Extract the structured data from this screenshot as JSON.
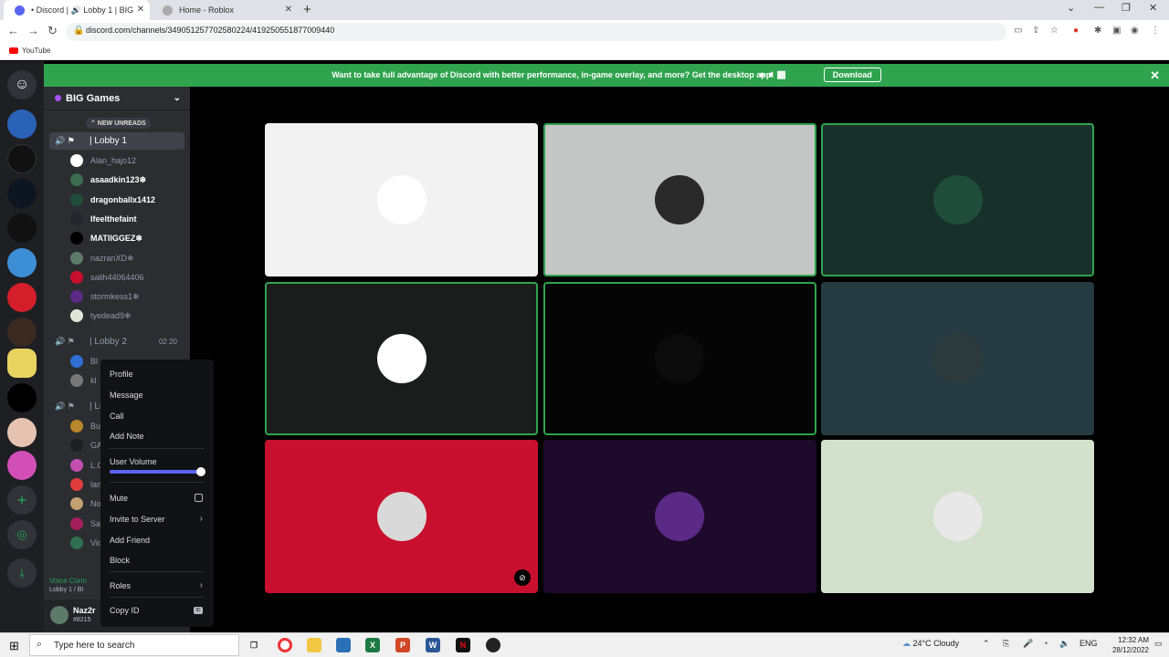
{
  "browser": {
    "tabs": [
      {
        "label": "• Discord | 🔊 Lobby 1 | BIG",
        "close": "✕"
      },
      {
        "label": "Home - Roblox",
        "close": "✕"
      }
    ],
    "new_tab": "+",
    "url": "discord.com/channels/349051257702580224/419250551877009440",
    "bookmark": "YouTube",
    "icons": {
      "back": "←",
      "forward": "→",
      "reload": "↻",
      "lock": "🔒",
      "minimize": "—",
      "maximize": "❐",
      "close": "✕",
      "dropdown": "⌄"
    }
  },
  "banner": {
    "text": "Want to take full advantage of Discord with better performance, in-game overlay, and more? Get the desktop app!",
    "download_label": "Download",
    "close": "✕"
  },
  "server": {
    "name": "BIG Games",
    "new_unreads": "⌃ NEW UNREADS",
    "channels": [
      {
        "name": "| Lobby 1",
        "active": true
      },
      {
        "name": "| Lobby 2",
        "count_a": "02",
        "count_b": "20"
      },
      {
        "name": "| Lo"
      }
    ],
    "lobby1_members": [
      {
        "name": "Alan_hajo12",
        "bright": false,
        "color": "#ffffff"
      },
      {
        "name": "asaadkin123❄",
        "bright": true,
        "color": "#3b6b4f"
      },
      {
        "name": "dragonballx1412",
        "bright": true,
        "color": "#1f4d3a"
      },
      {
        "name": "lfeelthefaint",
        "bright": true,
        "color": "#23262a"
      },
      {
        "name": "MATIIGGEZ❄",
        "bright": true,
        "color": "#000000"
      },
      {
        "name": "nazranXD❄",
        "bright": false,
        "color": "#5d7a6a"
      },
      {
        "name": "salih44064406",
        "bright": false,
        "color": "#c8102e"
      },
      {
        "name": "stormkess1❄",
        "bright": false,
        "color": "#5b2a86"
      },
      {
        "name": "tyedead9❄",
        "bright": false,
        "color": "#dfe6d8"
      }
    ],
    "lobby2_members": [
      {
        "name": "Bl",
        "color": "#2f6fd6"
      },
      {
        "name": "kl",
        "color": "#777777"
      }
    ],
    "lobby3_members": [
      {
        "name": "Bu",
        "color": "#b8862b"
      },
      {
        "name": "GA",
        "color": "#1e1f22"
      },
      {
        "name": "L.C",
        "color": "#c34fb0"
      },
      {
        "name": "lan",
        "color": "#e03e3e"
      },
      {
        "name": "No",
        "color": "#c4a070"
      },
      {
        "name": "Sa",
        "color": "#a3205a"
      },
      {
        "name": "Vic",
        "color": "#2f6f4f"
      }
    ]
  },
  "voice": {
    "status": "Voice Conn",
    "channel": "Lobby 1 / BI"
  },
  "user": {
    "name": "Naz2r",
    "tag": "#8215"
  },
  "context_menu": {
    "items": [
      "Profile",
      "Message",
      "Call",
      "Add Note"
    ],
    "volume_label": "User Volume",
    "volume_percent": 100,
    "mute": "Mute",
    "invite": "Invite to Server",
    "add_friend": "Add Friend",
    "block": "Block",
    "roles": "Roles",
    "copy_id": "Copy ID",
    "chevron": "›",
    "id_badge": "ID"
  },
  "tiles": [
    {
      "bg": "#f2f2f2",
      "avatar": "#ffffff",
      "speaking": false
    },
    {
      "bg": "#c4c6c5",
      "avatar": "#2a2a2a",
      "speaking": true
    },
    {
      "bg": "#18302a",
      "avatar": "#1f4d3a",
      "speaking": true
    },
    {
      "bg": "#1a1d1c",
      "avatar": "#ffffff",
      "speaking": true
    },
    {
      "bg": "#050505",
      "avatar": "#0b0b0b",
      "speaking": true
    },
    {
      "bg": "#253b41",
      "avatar": "#2c3a3c",
      "speaking": false
    },
    {
      "bg": "#c8102e",
      "avatar": "#d9d9d9",
      "speaking": false,
      "muted": true
    },
    {
      "bg": "#1e0a2a",
      "avatar": "#5b2a86",
      "speaking": false
    },
    {
      "bg": "#d2e0cc",
      "avatar": "#e8e8e8",
      "speaking": false
    }
  ],
  "taskbar": {
    "search_placeholder": "Type here to search",
    "weather": "24°C  Cloudy",
    "lang": "ENG",
    "time": "12:32 AM",
    "date": "28/12/2022",
    "start_icon": "⊞",
    "search_icon": "⌕"
  }
}
